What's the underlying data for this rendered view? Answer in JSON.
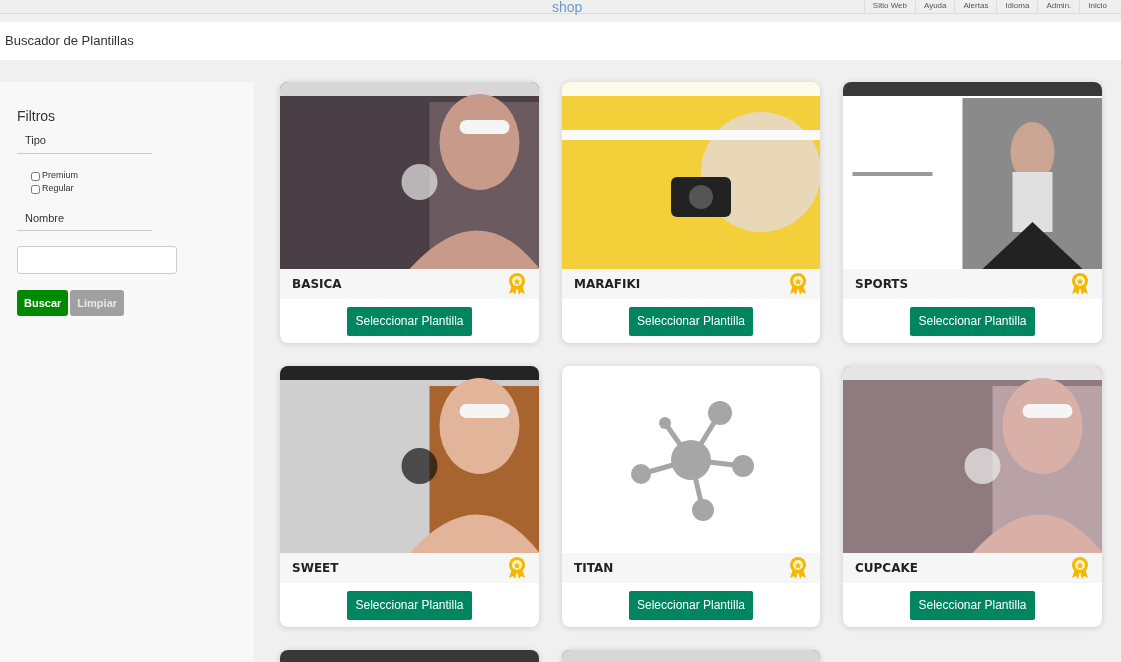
{
  "header": {
    "logo": "shop",
    "nav": [
      "Sitio Web",
      "Ayuda",
      "Alertas",
      "Idioma",
      "Admin.",
      "Inicio"
    ]
  },
  "page_title": "Buscador de Plantillas",
  "filters": {
    "title": "Filtros",
    "type_label": "Tipo",
    "types": [
      {
        "label": "Premium",
        "checked": false
      },
      {
        "label": "Regular",
        "checked": false
      }
    ],
    "name_label": "Nombre",
    "buttons": [
      {
        "label": "Buscar",
        "kind": "primary"
      },
      {
        "label": "Limpiar",
        "kind": "secondary"
      }
    ]
  },
  "templates": [
    {
      "name": "BASICA",
      "premium": true,
      "kind": "picture",
      "button": "Seleccionar Plantilla"
    },
    {
      "name": "MARAFIKI",
      "premium": true,
      "kind": "picture",
      "button": "Seleccionar Plantilla"
    },
    {
      "name": "SPORTS",
      "premium": true,
      "kind": "picture",
      "button": "Seleccionar Plantilla"
    },
    {
      "name": "SWEET",
      "premium": true,
      "kind": "picture",
      "button": "Seleccionar Plantilla"
    },
    {
      "name": "TITAN",
      "premium": true,
      "kind": "placeholder",
      "button": "Seleccionar Plantilla"
    },
    {
      "name": "CUPCAKE",
      "premium": true,
      "kind": "picture",
      "button": "Seleccionar Plantilla"
    },
    {
      "kind": "picture"
    },
    {
      "kind": "picture"
    }
  ]
}
